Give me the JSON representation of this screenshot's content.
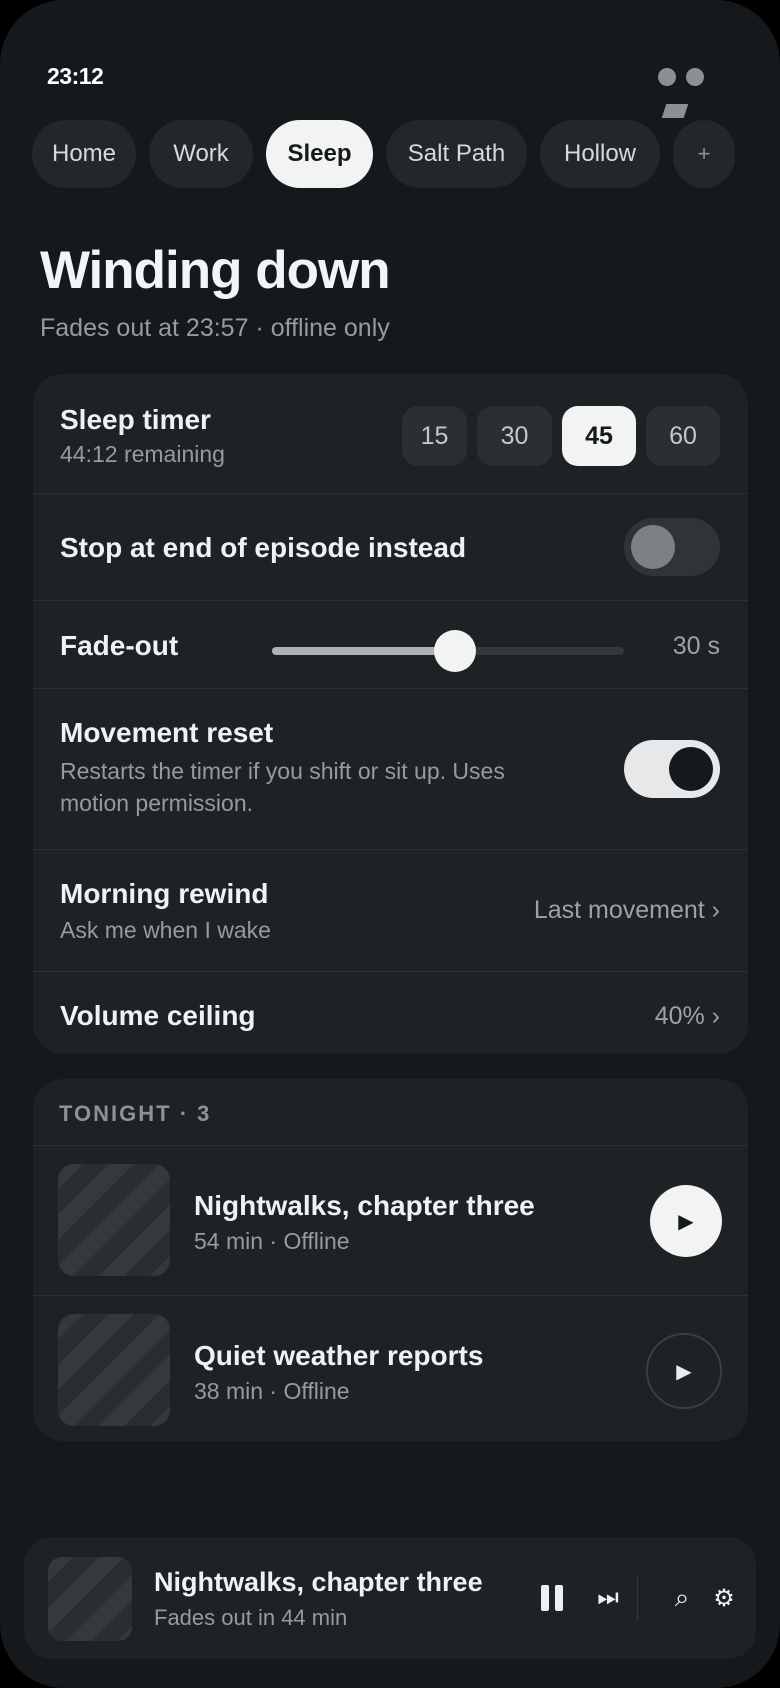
{
  "status": {
    "time": "23:12"
  },
  "tabs": [
    {
      "label": "Home",
      "active": false
    },
    {
      "label": "Work",
      "active": false
    },
    {
      "label": "Sleep",
      "active": true
    },
    {
      "label": "Salt Path",
      "active": false
    },
    {
      "label": "Hollow",
      "active": false
    },
    {
      "label": "+",
      "active": false
    }
  ],
  "header": {
    "title": "Winding down",
    "subtitle": "Fades out at 23:57 · offline only"
  },
  "settings": {
    "sleep_timer": {
      "title": "Sleep timer",
      "remaining": "44:12 remaining",
      "options": [
        "15",
        "30",
        "45",
        "60"
      ],
      "selected": "45"
    },
    "stop_at_end": {
      "title": "Stop at end of episode instead",
      "enabled": false
    },
    "fade_out": {
      "title": "Fade-out",
      "value_label": "30 s",
      "slider_fraction": 0.52
    },
    "movement_reset": {
      "title": "Movement reset",
      "description": "Restarts the timer if you shift or sit up. Uses motion permission.",
      "enabled": true
    },
    "morning_rewind": {
      "title": "Morning rewind",
      "subtitle": "Ask me when I wake",
      "value": "Last movement ›"
    },
    "volume_ceiling": {
      "title": "Volume ceiling",
      "value": "40% ›"
    }
  },
  "tonight": {
    "label": "TONIGHT · 3",
    "episodes": [
      {
        "title": "Nightwalks, chapter three",
        "meta": "54 min · Offline",
        "play_icon": "▶"
      },
      {
        "title": "Quiet weather reports",
        "meta": "38 min · Offline",
        "play_icon": "▶"
      }
    ]
  },
  "player": {
    "title": "Nightwalks, chapter three",
    "subtitle": "Fades out in 44 min",
    "icons": {
      "next": "⏭",
      "search": "⌕",
      "settings": "⚙"
    }
  },
  "colors": {
    "background": "#16191b",
    "card": "#1e2225",
    "accent": "#f2f3f3",
    "muted_text": "#979b9e"
  }
}
